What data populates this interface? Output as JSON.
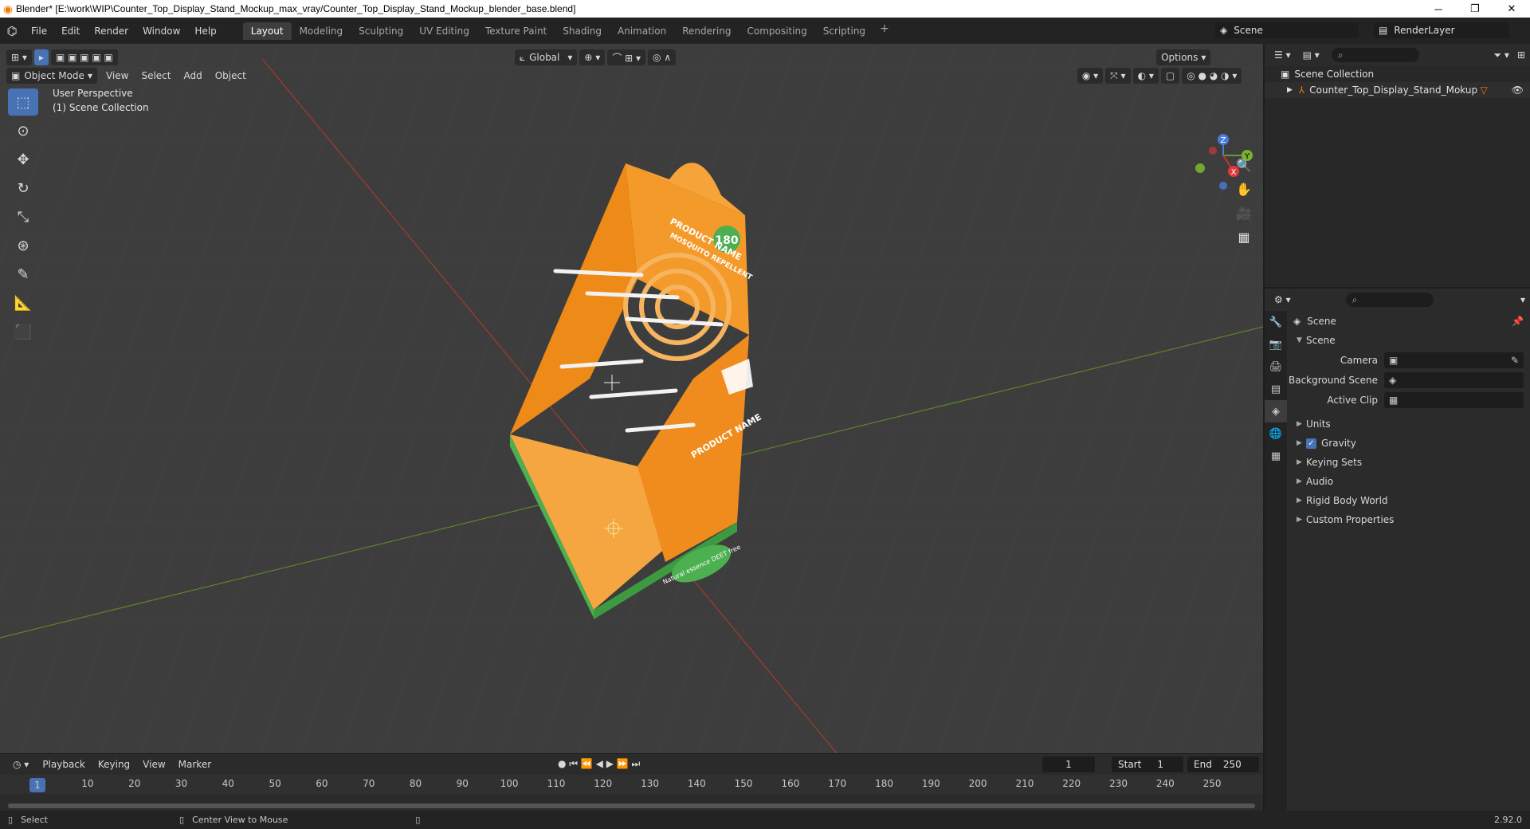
{
  "window": {
    "title": "Blender* [E:\\work\\WIP\\Counter_Top_Display_Stand_Mockup_max_vray/Counter_Top_Display_Stand_Mockup_blender_base.blend]",
    "minimize": "─",
    "maximize": "❐",
    "close": "✕"
  },
  "menu": [
    "File",
    "Edit",
    "Render",
    "Window",
    "Help"
  ],
  "workspaces": [
    "Layout",
    "Modeling",
    "Sculpting",
    "UV Editing",
    "Texture Paint",
    "Shading",
    "Animation",
    "Rendering",
    "Compositing",
    "Scripting"
  ],
  "active_workspace": "Layout",
  "scene_name": "Scene",
  "render_layer": "RenderLayer",
  "viewport": {
    "mode": "Object Mode",
    "menus": [
      "View",
      "Select",
      "Add",
      "Object"
    ],
    "transform_orientation": "Global",
    "options_label": "Options",
    "perspective_label": "User Perspective",
    "collection_label": "(1) Scene Collection",
    "gizmo_axes": [
      "X",
      "Y",
      "Z"
    ]
  },
  "product": {
    "name": "PRODUCT NAME",
    "subtitle": "MOSQUITO REPELLENT",
    "badge": "180",
    "side_name": "PRODUCT NAME",
    "tagline": "Natural essence DEET free"
  },
  "timeline": {
    "menus": [
      "Playback",
      "Keying",
      "View",
      "Marker"
    ],
    "current_frame": "1",
    "start_label": "Start",
    "start_value": "1",
    "end_label": "End",
    "end_value": "250",
    "ruler_marks": [
      "1",
      "10",
      "20",
      "30",
      "40",
      "50",
      "60",
      "70",
      "80",
      "90",
      "100",
      "110",
      "120",
      "130",
      "140",
      "150",
      "160",
      "170",
      "180",
      "190",
      "200",
      "210",
      "220",
      "230",
      "240",
      "250"
    ]
  },
  "status": {
    "left_action": "Select",
    "mid_action": "Center View to Mouse",
    "version": "2.92.0"
  },
  "outliner": {
    "root": "Scene Collection",
    "object": "Counter_Top_Display_Stand_Mokup"
  },
  "properties": {
    "context_title": "Scene",
    "section": "Scene",
    "fields": {
      "camera_label": "Camera",
      "background_label": "Background Scene",
      "clip_label": "Active Clip"
    },
    "panels": [
      "Units",
      "Gravity",
      "Keying Sets",
      "Audio",
      "Rigid Body World",
      "Custom Properties"
    ],
    "gravity_checked": true
  },
  "colors": {
    "accent": "#4772b3",
    "product_orange": "#f08a1c",
    "product_green": "#4caf50",
    "axis_red": "#c0392b",
    "axis_green": "#6a9a2a"
  }
}
